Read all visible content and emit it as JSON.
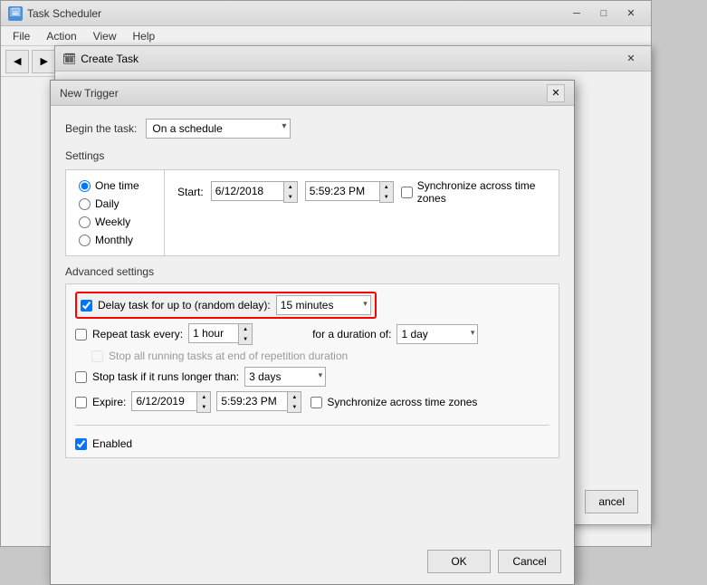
{
  "taskscheduler": {
    "title": "Task Scheduler",
    "icon": "🗓",
    "menu": {
      "file": "File",
      "action": "Action",
      "view": "View",
      "help": "Help"
    },
    "toolbar": {
      "back": "←",
      "forward": "→"
    }
  },
  "create_task_dialog": {
    "title": "Create Task",
    "icon": "🗓"
  },
  "new_trigger_dialog": {
    "title": "New Trigger",
    "begin_task_label": "Begin the task:",
    "begin_task_value": "On a schedule",
    "settings_label": "Settings",
    "schedule_options": [
      {
        "id": "one_time",
        "label": "One time",
        "selected": true
      },
      {
        "id": "daily",
        "label": "Daily",
        "selected": false
      },
      {
        "id": "weekly",
        "label": "Weekly",
        "selected": false
      },
      {
        "id": "monthly",
        "label": "Monthly",
        "selected": false
      }
    ],
    "start_label": "Start:",
    "start_date": "6/12/2018",
    "start_time": "5:59:23 PM",
    "sync_timezones": "Synchronize across time zones",
    "advanced_label": "Advanced settings",
    "delay_task_label": "Delay task for up to (random delay):",
    "delay_task_checked": true,
    "delay_value": "15 minutes",
    "repeat_task_label": "Repeat task every:",
    "repeat_task_checked": false,
    "repeat_value": "1 hour",
    "duration_label": "for a duration of:",
    "duration_value": "1 day",
    "stop_running_label": "Stop all running tasks at end of repetition duration",
    "stop_running_checked": false,
    "stop_if_runs_label": "Stop task if it runs longer than:",
    "stop_if_runs_checked": false,
    "stop_if_runs_value": "3 days",
    "expire_label": "Expire:",
    "expire_checked": false,
    "expire_date": "6/12/2019",
    "expire_time": "5:59:23 PM",
    "expire_sync": "Synchronize across time zones",
    "enabled_label": "Enabled",
    "enabled_checked": true,
    "ok_label": "OK",
    "cancel_label": "Cancel"
  },
  "create_task_cancel": "ancel"
}
